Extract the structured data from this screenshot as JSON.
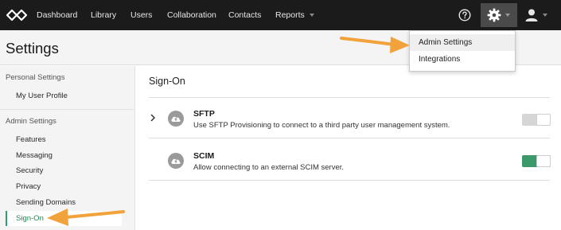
{
  "nav": {
    "items": [
      {
        "label": "Dashboard"
      },
      {
        "label": "Library"
      },
      {
        "label": "Users"
      },
      {
        "label": "Collaboration"
      },
      {
        "label": "Contacts"
      },
      {
        "label": "Reports"
      }
    ]
  },
  "settings_menu": {
    "items": [
      {
        "label": "Admin Settings",
        "active": true
      },
      {
        "label": "Integrations",
        "active": false
      }
    ]
  },
  "page": {
    "title": "Settings"
  },
  "sidebar": {
    "personal_heading": "Personal Settings",
    "personal_items": [
      {
        "label": "My User Profile"
      }
    ],
    "admin_heading": "Admin Settings",
    "admin_items": [
      {
        "label": "Features"
      },
      {
        "label": "Messaging"
      },
      {
        "label": "Security"
      },
      {
        "label": "Privacy"
      },
      {
        "label": "Sending Domains"
      },
      {
        "label": "Sign-On",
        "active": true
      }
    ]
  },
  "main": {
    "heading": "Sign-On",
    "integrations": [
      {
        "title": "SFTP",
        "description": "Use SFTP Provisioning to connect to a third party user management system.",
        "enabled": false
      },
      {
        "title": "SCIM",
        "description": "Allow connecting to an external SCIM server.",
        "enabled": true
      }
    ]
  },
  "colors": {
    "topnav_bg": "#1b1b1b",
    "accent_green": "#2e9e6a",
    "toggle_on": "#3c9a6a",
    "toggle_off": "#d6d6d6",
    "annotation_arrow": "#f2a23a"
  },
  "icons": [
    "logo-icon",
    "help-icon",
    "gear-icon",
    "user-icon",
    "chevron-right-icon",
    "cloud-upload-icon"
  ]
}
